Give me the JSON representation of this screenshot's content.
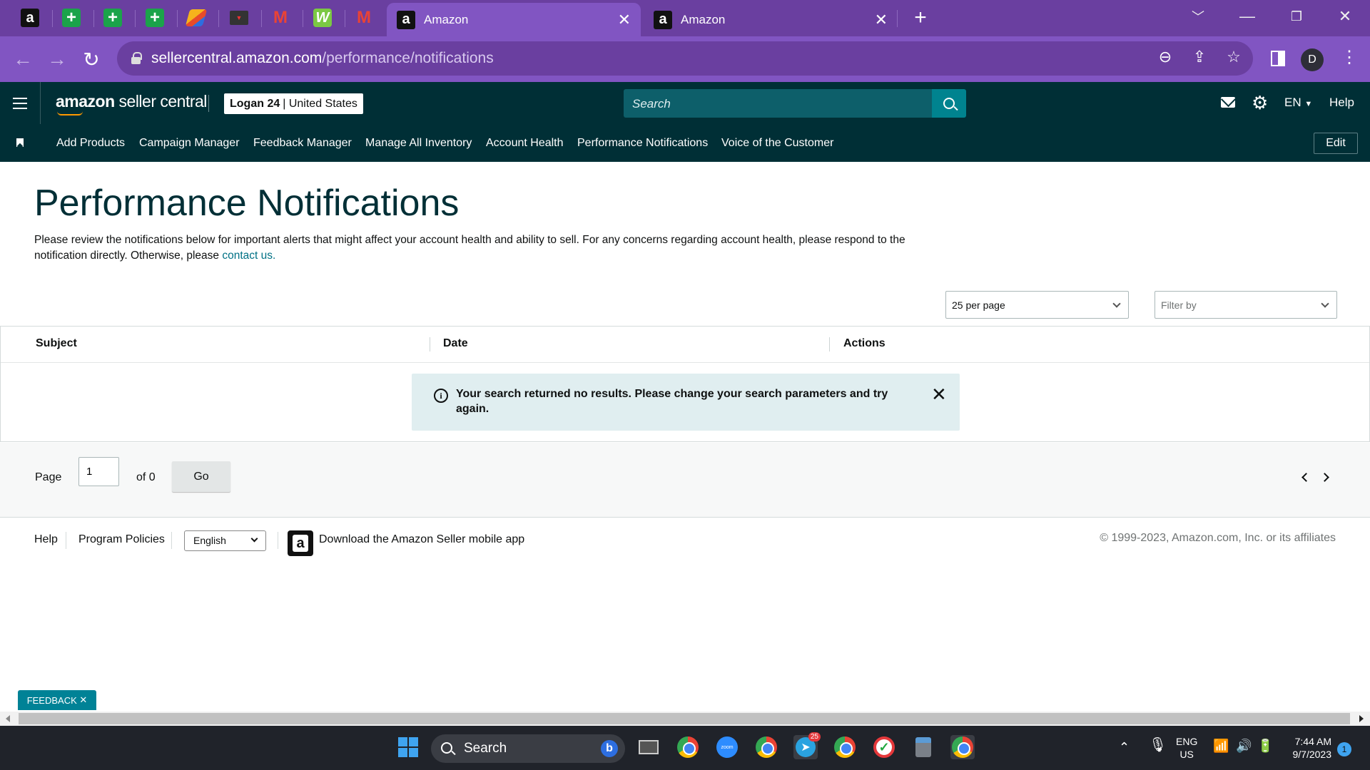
{
  "browser": {
    "tabs": [
      {
        "title": "Amazon",
        "active": true
      },
      {
        "title": "Amazon",
        "active": false
      }
    ],
    "url_host": "sellercentral.amazon.com",
    "url_path": "/performance/notifications",
    "profile_initial": "D"
  },
  "header": {
    "logo_bold": "amazon",
    "logo_rest": " seller central",
    "account_name": "Logan 24",
    "account_region": "| United States",
    "search_placeholder": "Search",
    "language": "EN",
    "help": "Help"
  },
  "bookmarks": {
    "items": [
      "Add Products",
      "Campaign Manager",
      "Feedback Manager",
      "Manage All Inventory",
      "Account Health",
      "Performance Notifications",
      "Voice of the Customer"
    ],
    "edit_label": "Edit"
  },
  "main": {
    "title": "Performance Notifications",
    "intro": "Please review the notifications below for important alerts that might affect your account health and ability to sell. For any concerns regarding account health, please respond to the notification directly. Otherwise, please ",
    "contact_link": "contact us.",
    "per_page": "25 per page",
    "filter_placeholder": "Filter by",
    "columns": [
      "Subject",
      "Date",
      "Actions"
    ],
    "alert_message": "Your search returned no results. Please change your search parameters and try again."
  },
  "pager": {
    "page_label": "Page",
    "page_value": "1",
    "of_label": "of 0",
    "go_label": "Go"
  },
  "footer": {
    "help": "Help",
    "program_policies": "Program Policies",
    "language": "English",
    "app_link": "Download the Amazon Seller mobile app",
    "copyright": "© 1999-2023, Amazon.com, Inc. or its affiliates",
    "feedback": "FEEDBACK"
  },
  "taskbar": {
    "search_label": "Search",
    "lang_line1": "ENG",
    "lang_line2": "US",
    "time": "7:44 AM",
    "date": "9/7/2023",
    "telegram_badge": "25",
    "notification_count": "1"
  }
}
